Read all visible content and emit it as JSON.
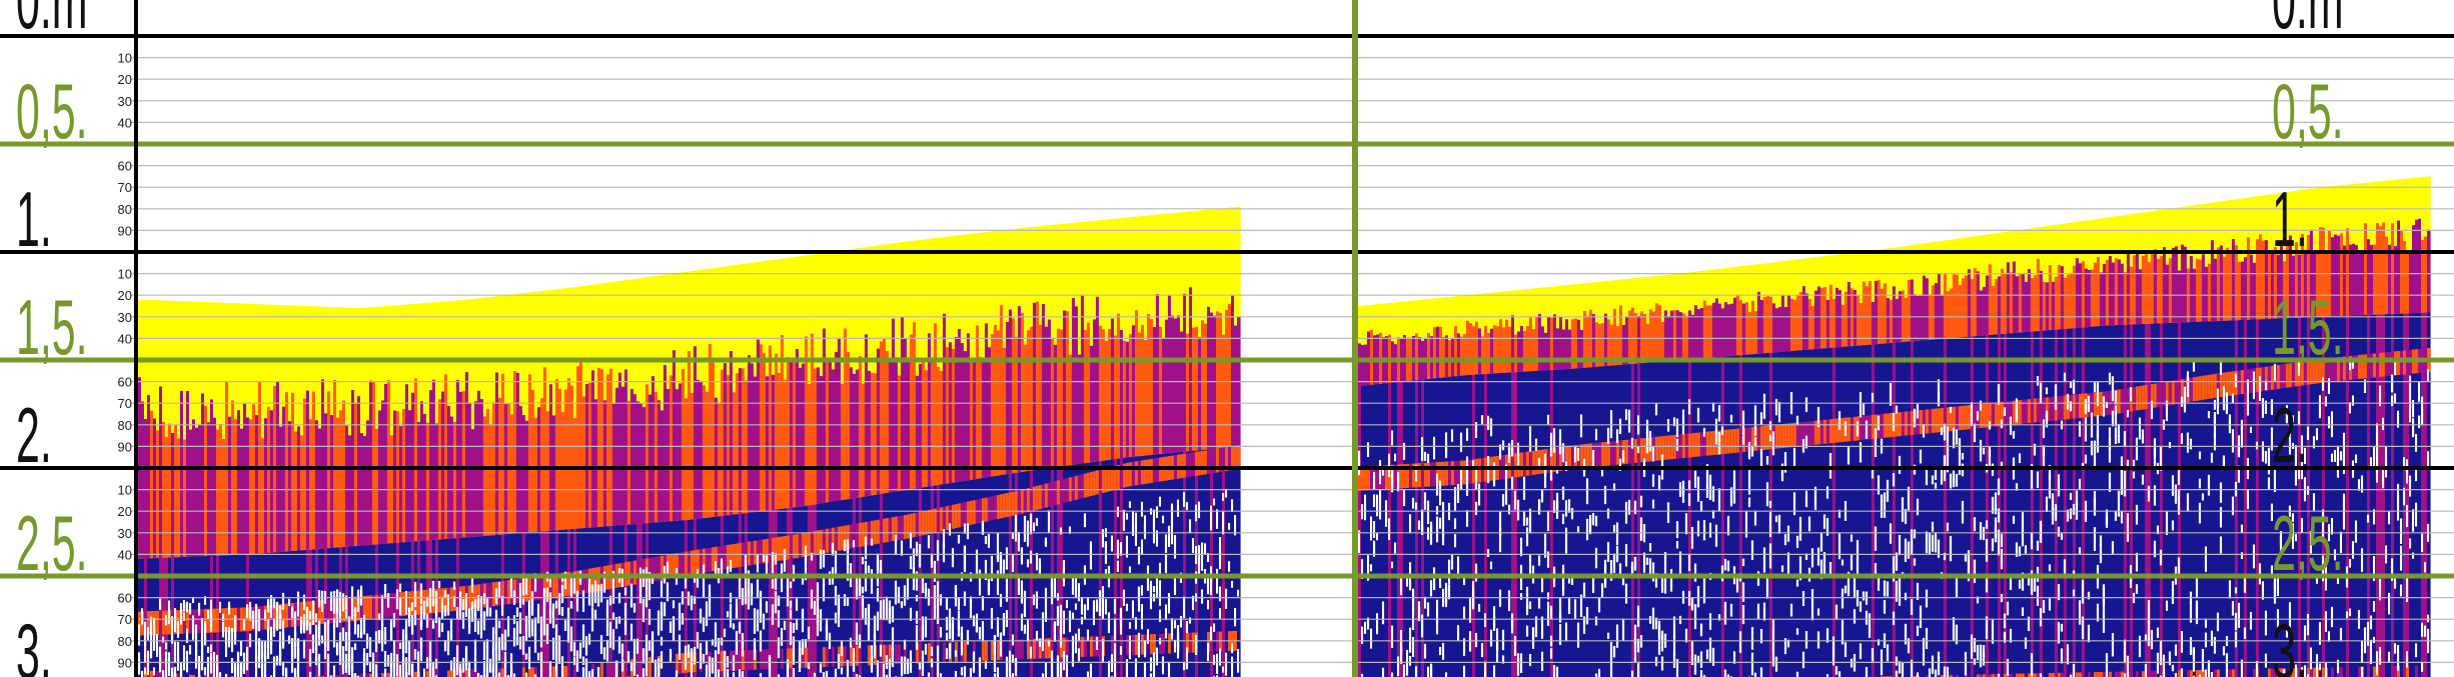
{
  "colors": {
    "surface": "#ffff00",
    "strong": "#ff5a10",
    "medium": "#a01088",
    "weak": "#161690",
    "half_meter_line": "#77992a",
    "meter_line": "#000000",
    "gridline": "#b8b8b8",
    "label_meter": "#111111",
    "label_half_meter": "#77992a"
  },
  "chart_data": {
    "type": "heatmap",
    "title": "",
    "depth_unit": "m",
    "depth_range": [
      0,
      3.15
    ],
    "depth_label_left": "0.m",
    "depth_label_right": "0.m",
    "depth_labels_left": [
      "0,5.",
      "1.",
      "1,5.",
      "2.",
      "2,5.",
      "3."
    ],
    "depth_labels_right": [
      "0,5.",
      "1.",
      "1,5.",
      "2.",
      "2,5.",
      "3."
    ],
    "depth_label_values": [
      0.5,
      1.0,
      1.5,
      2.0,
      2.5,
      3.0
    ],
    "centimeter_ticks": [
      "10",
      "20",
      "30",
      "40",
      "60",
      "70",
      "80",
      "90"
    ],
    "panels": [
      {
        "name": "left",
        "trace_x": [
          0,
          0.1,
          0.2,
          0.3,
          0.4,
          0.5,
          0.6,
          0.7,
          0.8,
          0.9,
          1.0
        ],
        "surface_depth_m": [
          1.22,
          1.24,
          1.26,
          1.22,
          1.16,
          1.09,
          1.02,
          0.95,
          0.89,
          0.84,
          0.79
        ],
        "strong_layer_bottom_m": [
          2.42,
          2.4,
          2.36,
          2.32,
          2.28,
          2.24,
          2.18,
          2.1,
          2.02,
          1.95,
          1.9
        ],
        "reflector_m": [
          2.72,
          2.7,
          2.65,
          2.6,
          2.53,
          2.44,
          2.36,
          2.27,
          2.16,
          2.03,
          1.95
        ],
        "lower_reflector_m": [
          2.98,
          3.03,
          3.0,
          2.98,
          2.96,
          2.9,
          2.88,
          2.86,
          2.84,
          2.82,
          2.8
        ]
      },
      {
        "name": "right",
        "trace_x": [
          0,
          0.1,
          0.2,
          0.3,
          0.4,
          0.5,
          0.6,
          0.7,
          0.8,
          0.9,
          1.0
        ],
        "surface_depth_m": [
          1.25,
          1.2,
          1.15,
          1.1,
          1.04,
          0.98,
          0.91,
          0.84,
          0.77,
          0.7,
          0.65
        ],
        "strong_layer_bottom_m": [
          1.62,
          1.57,
          1.54,
          1.5,
          1.46,
          1.42,
          1.38,
          1.34,
          1.32,
          1.3,
          1.28
        ],
        "reflector_m": [
          2.05,
          2.02,
          1.95,
          1.9,
          1.85,
          1.8,
          1.75,
          1.7,
          1.62,
          1.55,
          1.5
        ],
        "lower_reflector_m": [
          3.06,
          3.05,
          3.04,
          3.03,
          3.02,
          3.01,
          3.0,
          2.99,
          2.98,
          2.97,
          2.96
        ]
      }
    ]
  }
}
